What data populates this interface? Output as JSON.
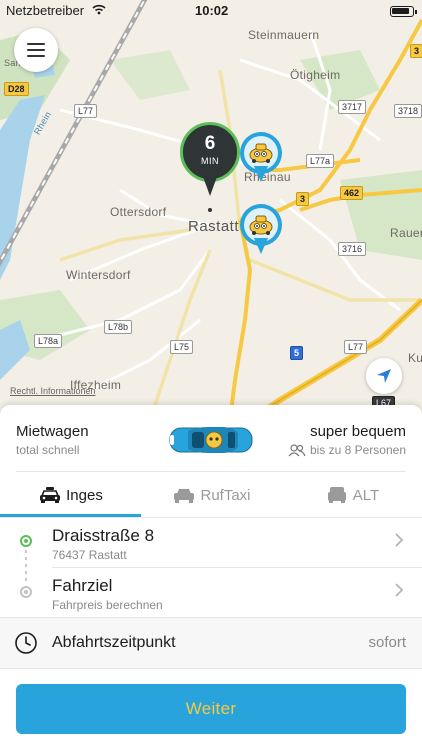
{
  "status_bar": {
    "carrier": "Netzbetreiber",
    "time": "10:02"
  },
  "map": {
    "places": {
      "steinmauern": "Steinmauern",
      "otigheim": "Ötigheim",
      "rheinau": "Rheinau",
      "ottersdorf": "Ottersdorf",
      "rastatt": "Rastatt",
      "rauental": "Rauer",
      "wintersdorf": "Wintersdorf",
      "iffezheim": "Iffezheim",
      "kuppenheim": "Ku",
      "sandweier": "Sand"
    },
    "roads": {
      "d28": "D28",
      "l77_a": "L77",
      "l77a": "L77a",
      "r3717": "3717",
      "r3718": "3718",
      "r3716": "3716",
      "r462": "462",
      "r3": "3",
      "r3_top": "3",
      "l78b": "L78b",
      "l78a": "L78a",
      "l75": "L75",
      "a5": "5",
      "l77_b": "L77",
      "l67": "L67"
    },
    "river_label": "Rhein",
    "legal_link": "Rechtl. Informationen",
    "eta": {
      "value": "6",
      "unit": "MIN"
    }
  },
  "sheet": {
    "vehicle": {
      "title": "Mietwagen",
      "subtitle": "total schnell",
      "comfort": "super bequem",
      "capacity": "bis zu 8 Personen",
      "accent": "#29a3dc"
    },
    "tabs": [
      {
        "label": "Inges",
        "active": true
      },
      {
        "label": "RufTaxi",
        "active": false
      },
      {
        "label": "ALT",
        "active": false
      }
    ],
    "pickup": {
      "title": "Draisstraße 8",
      "subtitle": "76437 Rastatt"
    },
    "destination": {
      "title": "Fahrziel",
      "subtitle": "Fahrpreis berechnen"
    },
    "departure": {
      "label": "Abfahrtszeitpunkt",
      "value": "sofort"
    },
    "cta": {
      "label": "Weiter"
    }
  },
  "colors": {
    "accent": "#29a3dc",
    "cta_text": "#f7c843",
    "green": "#5bbf59"
  }
}
